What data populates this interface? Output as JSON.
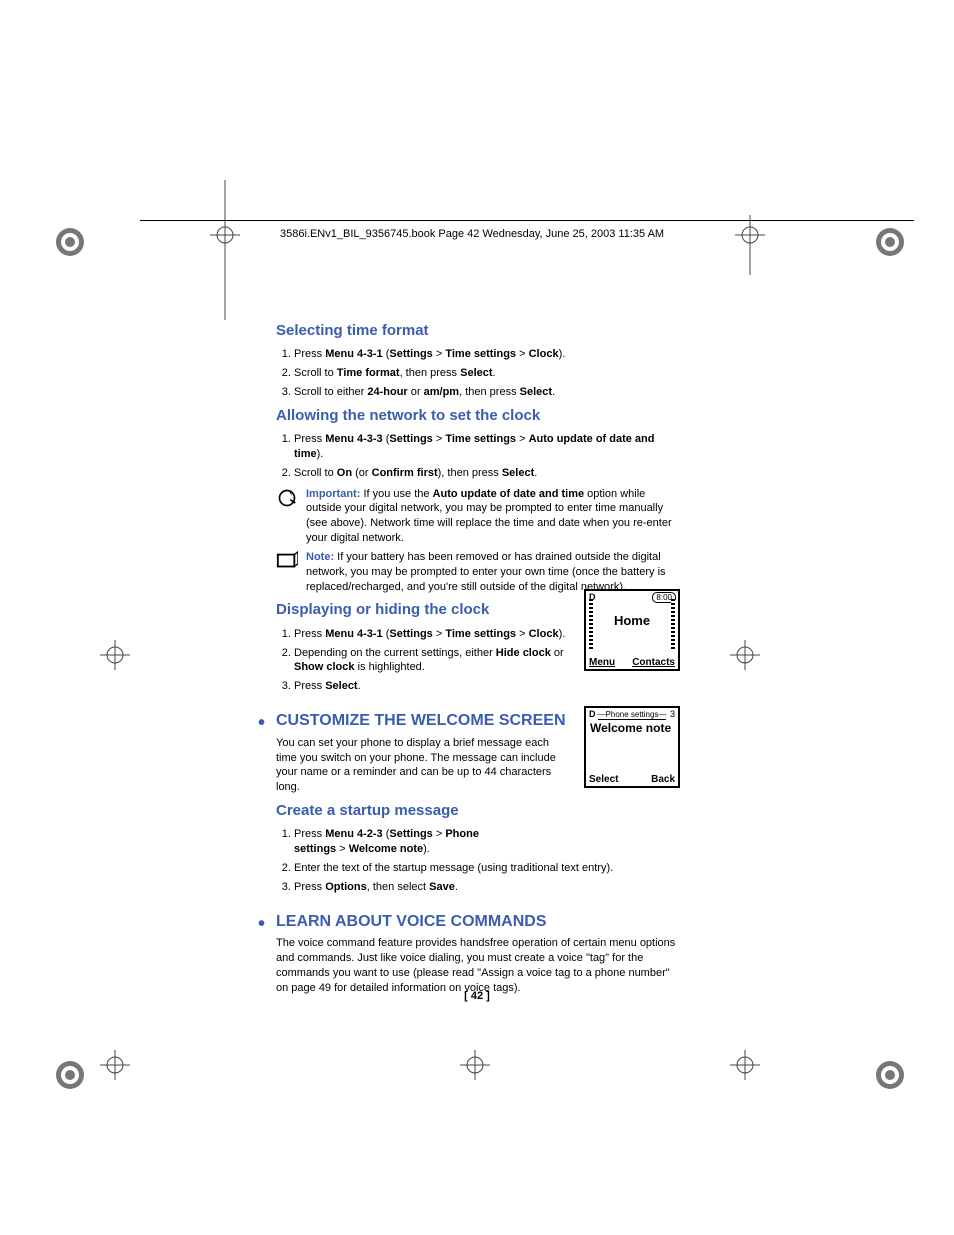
{
  "header": "3586i.ENv1_BIL_9356745.book  Page 42  Wednesday, June 25, 2003  11:35 AM",
  "page_number": "[ 42 ]",
  "sec1": {
    "title": "Selecting time format",
    "s1a": "Press ",
    "s1b": "Menu 4-3-1",
    "s1c": " (",
    "s1d": "Settings",
    "s1e": " > ",
    "s1f": "Time settings",
    "s1g": " > ",
    "s1h": "Clock",
    "s1i": ").",
    "s2a": "Scroll to ",
    "s2b": "Time format",
    "s2c": ", then press ",
    "s2d": "Select",
    "s2e": ".",
    "s3a": "Scroll to either ",
    "s3b": "24-hour",
    "s3c": " or ",
    "s3d": "am/pm",
    "s3e": ", then press ",
    "s3f": "Select",
    "s3g": "."
  },
  "sec2": {
    "title": "Allowing the network to set the clock",
    "s1a": "Press ",
    "s1b": "Menu 4-3-3",
    "s1c": " (",
    "s1d": "Settings",
    "s1e": " > ",
    "s1f": "Time settings",
    "s1g": " > ",
    "s1h": "Auto update of date and time",
    "s1i": ").",
    "s2a": "Scroll to ",
    "s2b": "On",
    "s2c": " (or ",
    "s2d": "Confirm first",
    "s2e": "), then press ",
    "s2f": "Select",
    "s2g": ".",
    "imp_label": "Important:",
    "imp_a": " If you use the ",
    "imp_b": "Auto update of date and time",
    "imp_c": " option while outside your digital network, you may be prompted to enter time manually (see above). Network time will replace the time and date when you re-enter your digital network.",
    "note_label": "Note:",
    "note_text": " If your battery has been removed or has drained outside the digital network, you may be prompted to enter your own time (once the battery is replaced/recharged, and you're still outside of the digital network)."
  },
  "sec3": {
    "title": "Displaying or hiding the clock",
    "s1a": "Press ",
    "s1b": "Menu 4-3-1",
    "s1c": " (",
    "s1d": "Settings",
    "s1e": " > ",
    "s1f": "Time settings",
    "s1g": " > ",
    "s1h": "Clock",
    "s1i": ").",
    "s2a": "Depending on the current settings, either ",
    "s2b": "Hide clock",
    "s2c": " or ",
    "s2d": "Show clock",
    "s2e": " is highlighted.",
    "s3a": "Press ",
    "s3b": "Select",
    "s3c": "."
  },
  "sec4": {
    "title": "CUSTOMIZE THE WELCOME SCREEN",
    "intro": "You can set your phone to display a brief message each time you switch on your phone. The message can include your name or a reminder and can be up to 44 characters long.",
    "sub": "Create a startup message",
    "s1a": "Press ",
    "s1b": "Menu 4-2-3",
    "s1c": " (",
    "s1d": "Settings",
    "s1e": " > ",
    "s1f": "Phone settings",
    "s1g": " > ",
    "s1h": "Welcome note",
    "s1i": ").",
    "s2": "Enter the text of the startup message (using traditional text entry).",
    "s3a": "Press ",
    "s3b": "Options",
    "s3c": ", then select ",
    "s3d": "Save",
    "s3e": "."
  },
  "sec5": {
    "title": "LEARN ABOUT VOICE COMMANDS",
    "intro": "The voice command feature provides handsfree operation of certain menu options and commands. Just like voice dialing, you must create a voice \"tag\" for the commands you want to use (please read \"Assign a voice tag to a phone number\" on page 49 for detailed information on voice tags)."
  },
  "fig1": {
    "tlD": "D",
    "time": "8:00",
    "home": "Home",
    "menu": "Menu",
    "contacts": "Contacts"
  },
  "fig2": {
    "tlD": "D",
    "header": "Phone settings",
    "num": "3",
    "title": "Welcome note",
    "select": "Select",
    "back": "Back"
  }
}
